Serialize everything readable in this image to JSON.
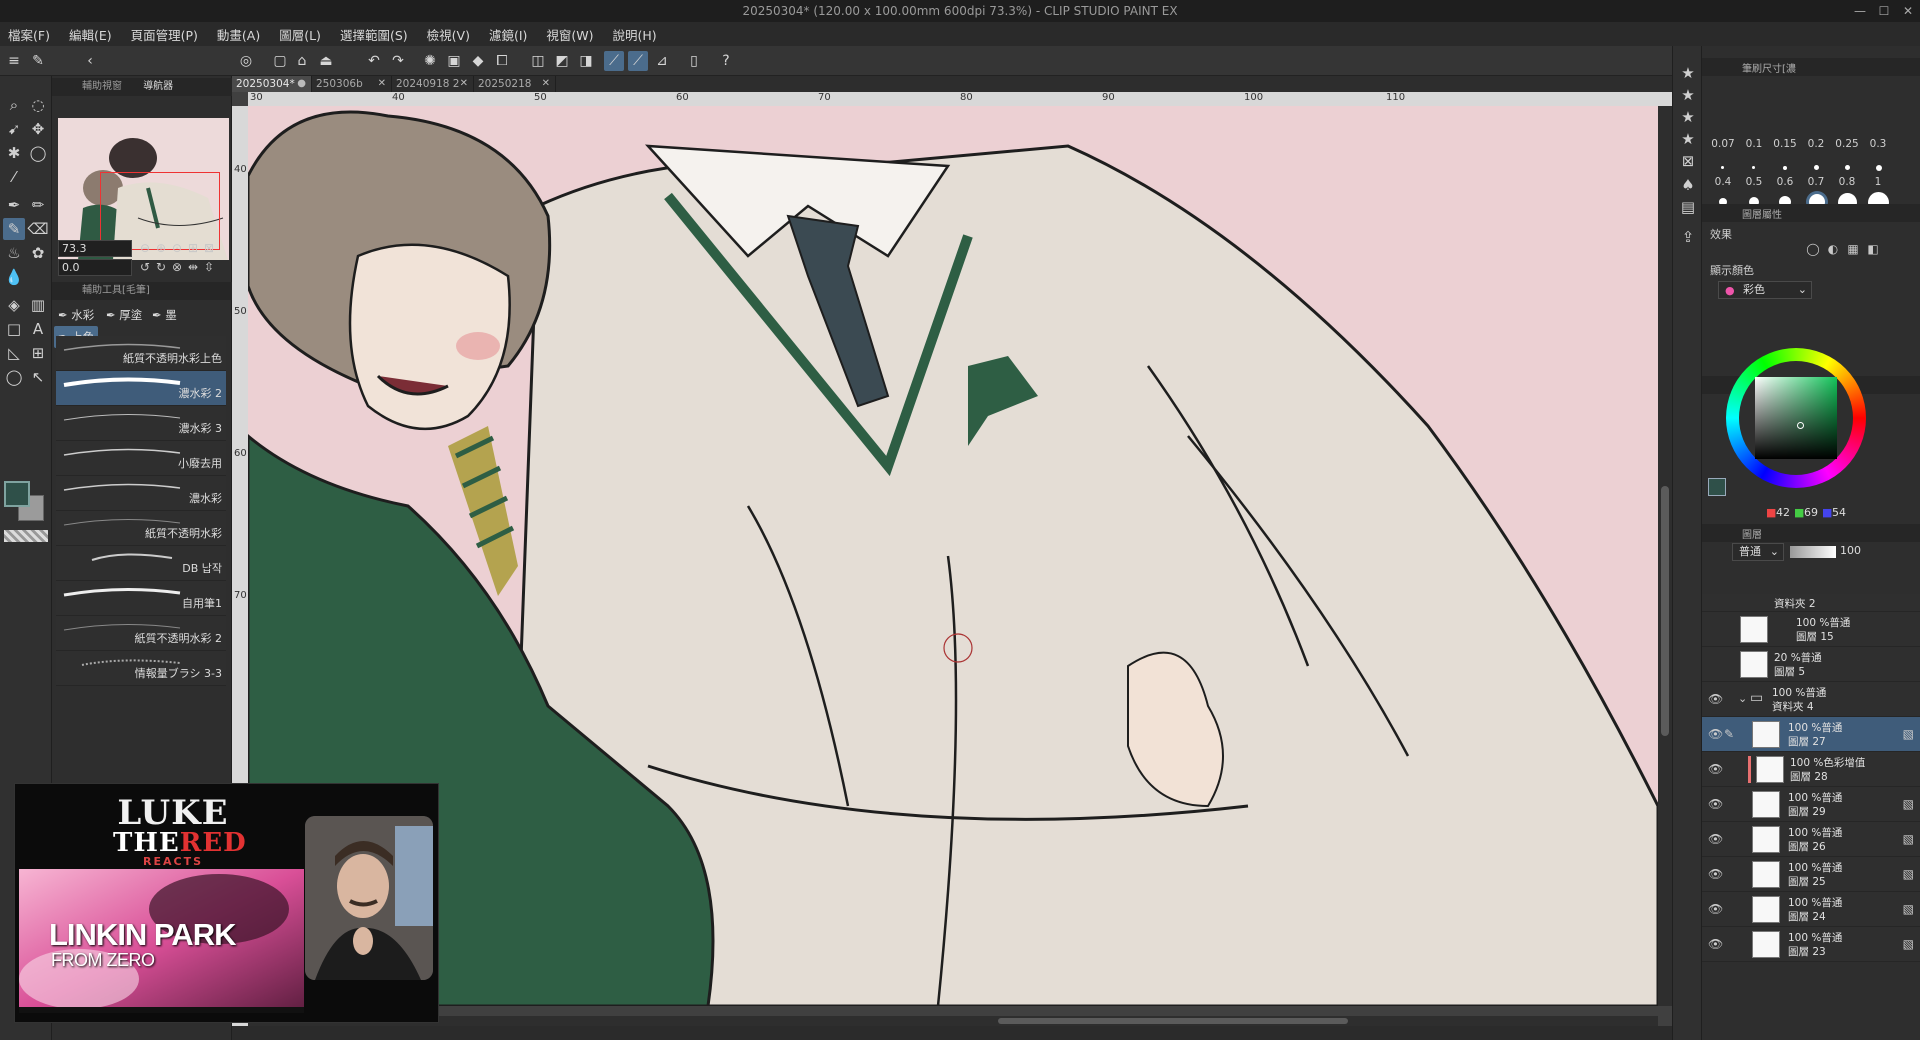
{
  "titlebar": {
    "title": "20250304* (120.00 x 100.00mm 600dpi 73.3%)  - CLIP STUDIO PAINT EX",
    "minimize": "—",
    "maximize": "☐",
    "close": "✕"
  },
  "menu": {
    "file": "檔案(F)",
    "edit": "編輯(E)",
    "page": "頁面管理(P)",
    "animation": "動畫(A)",
    "layer": "圖層(L)",
    "selection": "選擇範圍(S)",
    "view": "檢視(V)",
    "filter": "濾鏡(I)",
    "window": "視窗(W)",
    "help": "說明(H)"
  },
  "navigator": {
    "tab_subview": "輔助視窗",
    "tab_navigator": "導航器",
    "zoom_value": "73.3",
    "rotate_value": "0.0"
  },
  "subtool": {
    "header": "輔助工具[毛筆]",
    "tabs": {
      "watercolor": "水彩",
      "thick": "厚塗",
      "ink": "墨",
      "coloring": "上色"
    },
    "brushes": [
      {
        "name": "紙質不透明水彩上色"
      },
      {
        "name": "濃水彩 2"
      },
      {
        "name": "濃水彩 3"
      },
      {
        "name": "小廢去用"
      },
      {
        "name": "濃水彩"
      },
      {
        "name": "紙質不透明水彩"
      },
      {
        "name": "DB 납작"
      },
      {
        "name": "自用筆1"
      },
      {
        "name": "紙質不透明水彩 2"
      },
      {
        "name": "情報量ブラシ 3-3"
      }
    ]
  },
  "documents": {
    "tabs": [
      {
        "label": "20250304*",
        "active": true,
        "marker": "●"
      },
      {
        "label": "250306b",
        "close": "✕"
      },
      {
        "label": "20240918 2",
        "close": "✕"
      },
      {
        "label": "20250218",
        "close": "✕"
      }
    ],
    "ruler_h": [
      "30",
      "40",
      "50",
      "60",
      "70",
      "80",
      "90",
      "100",
      "110"
    ],
    "ruler_v": [
      "40",
      "50",
      "60",
      "70"
    ]
  },
  "stream_overlay": {
    "logo_line1": "LUKE",
    "logo_line2_a": "THE",
    "logo_line2_b": "RED",
    "logo_line3": "REACTS",
    "video_title": "LINKIN PARK",
    "video_subtitle": "FROM ZERO"
  },
  "brush_size": {
    "header": "筆刷尺寸[濃",
    "sizes": [
      "0.07",
      "0.1",
      "0.15",
      "0.2",
      "0.25",
      "0.3",
      "0.4",
      "0.5",
      "0.6",
      "0.7",
      "0.8",
      "1"
    ]
  },
  "layer_property": {
    "header": "圖層屬性",
    "effect_label": "效果",
    "display_color_label": "顯示顏色",
    "display_color_value": "彩色"
  },
  "color": {
    "r": "42",
    "g": "69",
    "b": "54",
    "main_color": "#2f5049",
    "sub_color": "#9b9b9b"
  },
  "layers": {
    "tab_layer": "圖層",
    "blend_mode": "普通",
    "opacity": "100",
    "items": [
      {
        "line1": "資料夾 2",
        "line2": ""
      },
      {
        "line1": "100 %普通",
        "line2": "圖層 15"
      },
      {
        "line1": "20 %普通",
        "line2": "圖層 5"
      },
      {
        "line1": "100 %普通",
        "line2": "資料夾 4"
      },
      {
        "line1": "100 %普通",
        "line2": "圖層 27"
      },
      {
        "line1": "100 %色彩增值",
        "line2": "圖層 28"
      },
      {
        "line1": "100 %普通",
        "line2": "圖層 29"
      },
      {
        "line1": "100 %普通",
        "line2": "圖層 26"
      },
      {
        "line1": "100 %普通",
        "line2": "圖層 25"
      },
      {
        "line1": "100 %普通",
        "line2": "圖層 24"
      },
      {
        "line1": "100 %普通",
        "line2": "圖層 23"
      }
    ]
  }
}
